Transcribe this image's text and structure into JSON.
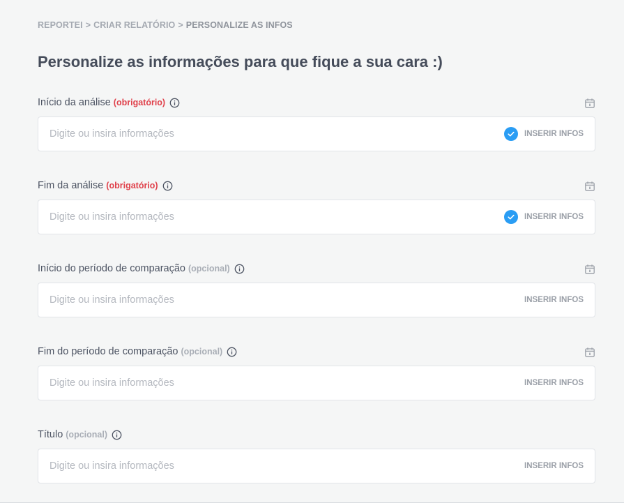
{
  "breadcrumb": {
    "items": [
      "REPORTEI",
      "CRIAR RELATÓRIO",
      "PERSONALIZE AS INFOS"
    ],
    "separator": ">"
  },
  "page_title": "Personalize as informações para que fique a sua cara :)",
  "colors": {
    "accent": "#2a9df4",
    "required": "#e0424c",
    "optional": "#a9aeb6",
    "background": "#f5f6f6"
  },
  "fields": [
    {
      "label": "Início da análise",
      "tag": "(obrigatório)",
      "tag_type": "required",
      "placeholder": "Digite ou insira informações",
      "value": "",
      "button_label": "INSERIR INFOS",
      "checked": true,
      "has_calendar": true
    },
    {
      "label": "Fim da análise",
      "tag": "(obrigatório)",
      "tag_type": "required",
      "placeholder": "Digite ou insira informações",
      "value": "",
      "button_label": "INSERIR INFOS",
      "checked": true,
      "has_calendar": true
    },
    {
      "label": "Início do período de comparação",
      "tag": "(opcional)",
      "tag_type": "optional",
      "placeholder": "Digite ou insira informações",
      "value": "",
      "button_label": "INSERIR INFOS",
      "checked": false,
      "has_calendar": true
    },
    {
      "label": "Fim do período de comparação",
      "tag": "(opcional)",
      "tag_type": "optional",
      "placeholder": "Digite ou insira informações",
      "value": "",
      "button_label": "INSERIR INFOS",
      "checked": false,
      "has_calendar": true
    },
    {
      "label": "Título",
      "tag": "(opcional)",
      "tag_type": "optional",
      "placeholder": "Digite ou insira informações",
      "value": "",
      "button_label": "INSERIR INFOS",
      "checked": false,
      "has_calendar": false
    }
  ],
  "icons": {
    "info": "info-icon",
    "calendar": "calendar-icon",
    "check": "check-circle-icon"
  }
}
